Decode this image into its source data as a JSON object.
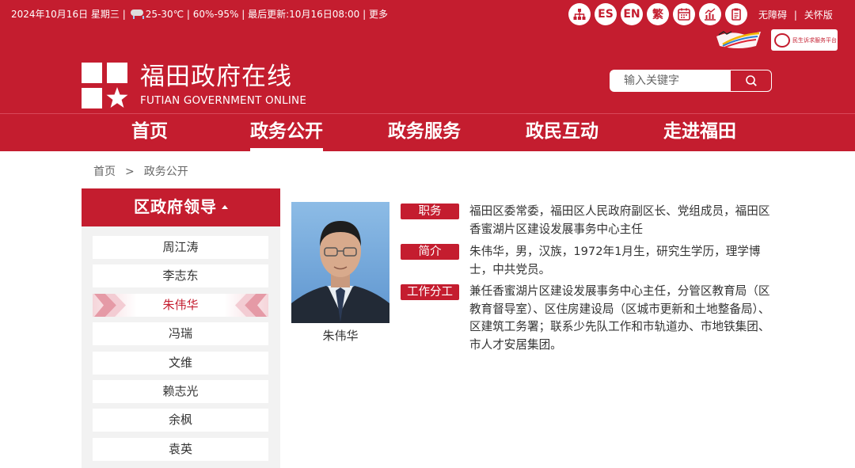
{
  "topbar": {
    "date": "2024年10月16日 星期三 |",
    "weather_icon": "cloud-rain-icon",
    "temp": "25-30℃ | 60%-95% | 最后更新:10月16日08:00 |",
    "more": "更多"
  },
  "tool_icons": {
    "sitemap": "sitemap-icon",
    "es": "ES",
    "en": "EN",
    "traditional": "繁",
    "calendar": "calendar-icon",
    "chart": "chart-icon",
    "clipboard": "clipboard-icon"
  },
  "accessibility": {
    "barrier_free": "无障碍",
    "separator": "|",
    "elder_mode": "关怀版"
  },
  "badges": {
    "service_platform": "民生诉求服务平台"
  },
  "brand": {
    "title": "福田政府在线",
    "subtitle": "FUTIAN GOVERNMENT ONLINE"
  },
  "search": {
    "placeholder": "输入关键字"
  },
  "nav": {
    "items": [
      {
        "label": "首页"
      },
      {
        "label": "政务公开"
      },
      {
        "label": "政务服务"
      },
      {
        "label": "政民互动"
      },
      {
        "label": "走进福田"
      }
    ],
    "active": "政务公开"
  },
  "breadcrumb": {
    "home": "首页",
    "sep": ">",
    "current": "政务公开"
  },
  "sidebar": {
    "title": "区政府领导",
    "items": [
      {
        "label": "周江涛"
      },
      {
        "label": "李志东"
      },
      {
        "label": "朱伟华"
      },
      {
        "label": "冯瑞"
      },
      {
        "label": "文维"
      },
      {
        "label": "赖志光"
      },
      {
        "label": "余枫"
      },
      {
        "label": "袁英"
      }
    ],
    "active": "朱伟华"
  },
  "profile": {
    "name": "朱伟华",
    "fields": [
      {
        "label": "职务",
        "text": "福田区委常委，福田区人民政府副区长、党组成员，福田区香蜜湖片区建设发展事务中心主任"
      },
      {
        "label": "简介",
        "text": "朱伟华，男，汉族，1972年1月生，研究生学历，理学博士，中共党员。"
      },
      {
        "label": "工作分工",
        "text": "兼任香蜜湖片区建设发展事务中心主任，分管区教育局（区教育督导室）、区住房建设局（区城市更新和土地整备局）、区建筑工务署；联系少先队工作和市轨道办、市地铁集团、市人才安居集团。"
      }
    ]
  },
  "colors": {
    "brand_red": "#c41d2f",
    "sidebar_bg": "#f2f2f2"
  }
}
